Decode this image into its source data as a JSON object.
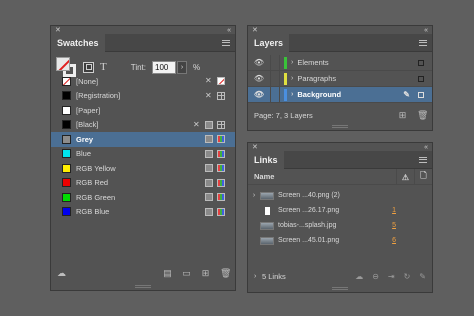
{
  "swatches": {
    "title": "Swatches",
    "tint_label": "Tint:",
    "tint_value": "100",
    "tint_unit": "%",
    "items": [
      {
        "name": "[None]",
        "chip": "none",
        "icons": [
          "locked",
          "noprint"
        ]
      },
      {
        "name": "[Registration]",
        "chip": "#000000",
        "icons": [
          "locked",
          "registration"
        ]
      },
      {
        "name": "[Paper]",
        "chip": "#ffffff",
        "icons": []
      },
      {
        "name": "[Black]",
        "chip": "#000000",
        "icons": [
          "locked",
          "process",
          "cmyk"
        ]
      },
      {
        "name": "Grey",
        "chip": "#8c8c8c",
        "icons": [
          "process",
          "rgb"
        ],
        "selected": true
      },
      {
        "name": "Blue",
        "chip": "#00e5ee",
        "icons": [
          "process",
          "rgb"
        ]
      },
      {
        "name": "RGB Yellow",
        "chip": "#ffee00",
        "icons": [
          "process",
          "rgb"
        ]
      },
      {
        "name": "RGB Red",
        "chip": "#ee0000",
        "icons": [
          "process",
          "rgb"
        ]
      },
      {
        "name": "RGB Green",
        "chip": "#00dd00",
        "icons": [
          "process",
          "rgb"
        ]
      },
      {
        "name": "RGB Blue",
        "chip": "#0000ee",
        "icons": [
          "process",
          "rgb"
        ]
      }
    ]
  },
  "layers": {
    "title": "Layers",
    "items": [
      {
        "name": "Elements",
        "color": "#39c239"
      },
      {
        "name": "Paragraphs",
        "color": "#e0e040"
      },
      {
        "name": "Background",
        "color": "#4a8fe0",
        "selected": true
      }
    ],
    "status": "Page: 7, 3 Layers"
  },
  "links": {
    "title": "Links",
    "column_name": "Name",
    "items": [
      {
        "name": "Screen ...40.png (2)",
        "page": "",
        "expandable": true,
        "thumb": "wide"
      },
      {
        "name": "Screen ...26.17.png",
        "page": "1",
        "thumb": "small"
      },
      {
        "name": "tobias-...splash.jpg",
        "page": "5",
        "thumb": "wide"
      },
      {
        "name": "Screen ...45.01.png",
        "page": "6",
        "thumb": "wide"
      }
    ],
    "status": "5 Links"
  },
  "colors": {
    "selection": "#4b6f94",
    "panel_bg": "#535353",
    "workspace_bg": "#5f5f5f"
  }
}
